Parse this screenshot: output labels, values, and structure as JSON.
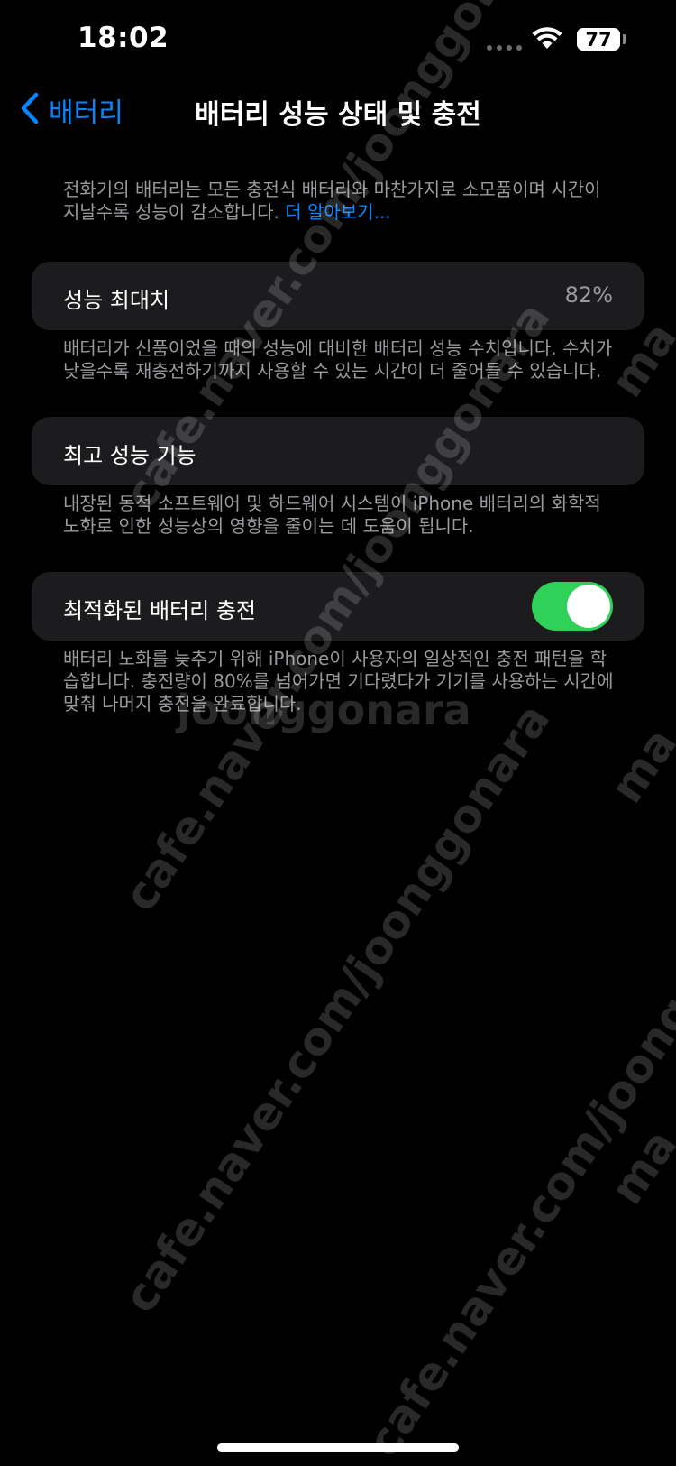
{
  "status_bar": {
    "time": "18:02",
    "battery_level": "77",
    "icons": [
      "cellular-dots-icon",
      "wifi-icon",
      "battery-icon"
    ]
  },
  "nav": {
    "back_label": "배터리",
    "title": "배터리 성능 상태 및 충전",
    "back_icon": "chevron-left-icon"
  },
  "intro": {
    "text": "전화기의 배터리는 모든 충전식 배터리와 마찬가지로 소모품이며 시간이 지날수록 성능이 감소합니다. ",
    "link": "더 알아보기..."
  },
  "sections": {
    "max_capacity": {
      "label": "성능 최대치",
      "value": "82%",
      "footer": "배터리가 신품이었을 때의 성능에 대비한 배터리 성능 수치입니다. 수치가 낮을수록 재충전하기까지 사용할 수 있는 시간이 더 줄어들 수 있습니다."
    },
    "peak_performance": {
      "label": "최고 성능 기능",
      "footer": "내장된 동적 소프트웨어 및 하드웨어 시스템이 iPhone 배터리의 화학적 노화로 인한 성능상의 영향을 줄이는 데 도움이 됩니다."
    },
    "optimized_charging": {
      "label": "최적화된 배터리 충전",
      "enabled": true,
      "footer": "배터리 노화를 늦추기 위해 iPhone이 사용자의 일상적인 충전 패턴을 학습합니다. 충전량이 80%를 넘어가면 기다렸다가 기기를 사용하는 시간에 맞춰 나머지 충전을 완료합니다."
    }
  },
  "watermarks": {
    "url": "cafe.naver.com/joonggonara",
    "brand": "joonggonara",
    "edge": "ma"
  },
  "colors": {
    "accent": "#0a84ff",
    "toggle_on": "#30d158",
    "cell_bg": "#1c1c1e",
    "secondary_text": "#9a9a9f"
  }
}
